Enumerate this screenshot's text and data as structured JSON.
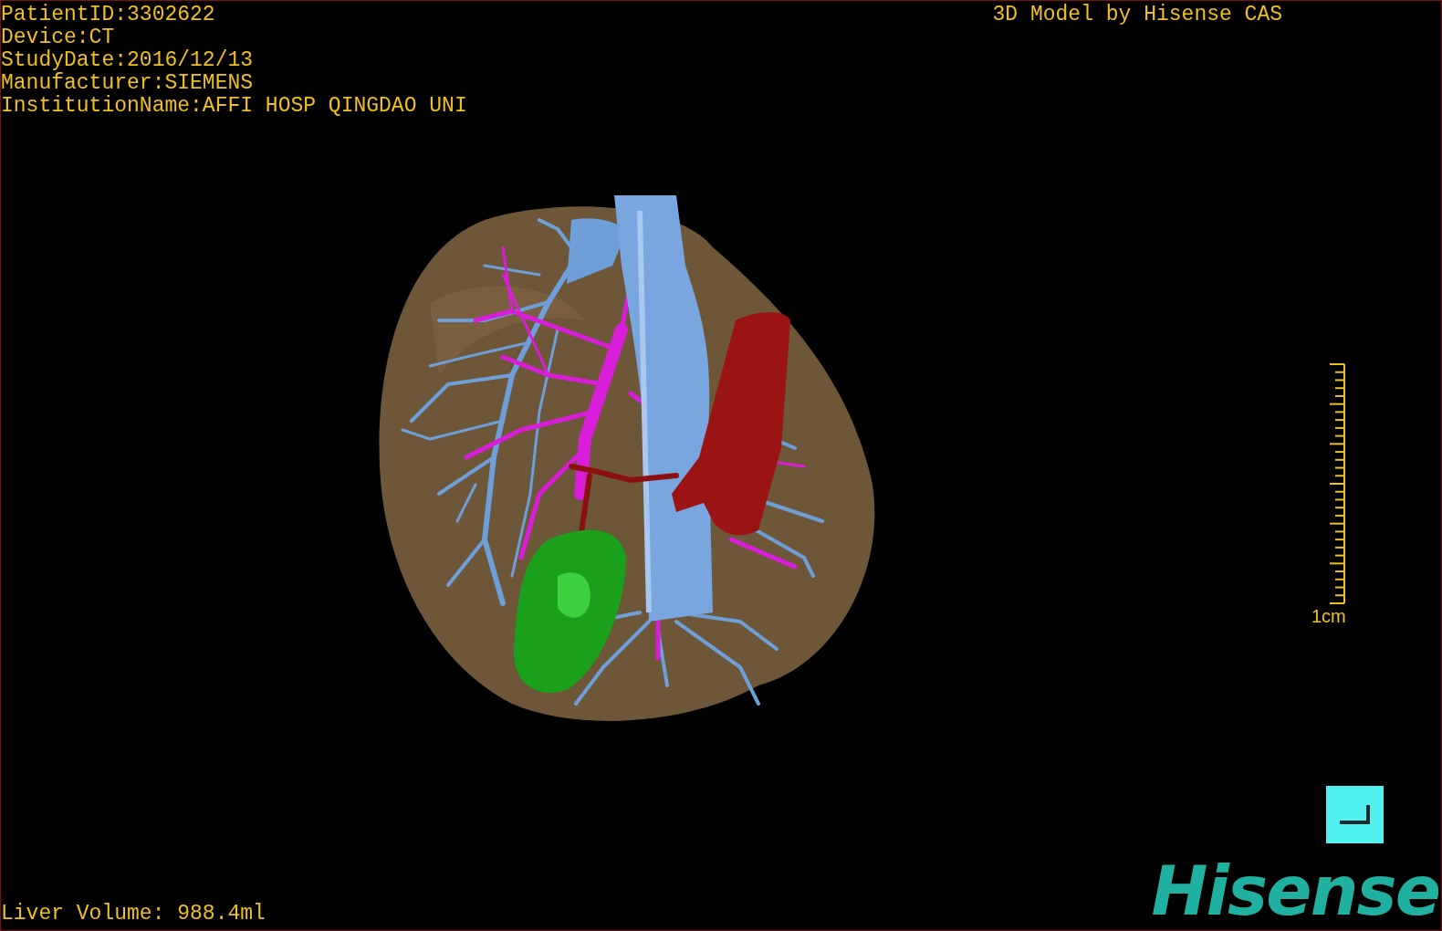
{
  "patient_info": [
    {
      "text": "PatientID:3302622"
    },
    {
      "text": "Device:CT"
    },
    {
      "text": "StudyDate:2016/12/13"
    },
    {
      "text": "Manufacturer:SIEMENS"
    },
    {
      "text": "InstitutionName:AFFI HOSP QINGDAO UNI"
    }
  ],
  "title": "3D Model by Hisense CAS",
  "scale": {
    "label": "1cm"
  },
  "liver_volume": "Liver Volume: 988.4ml",
  "logo": "Hisense"
}
